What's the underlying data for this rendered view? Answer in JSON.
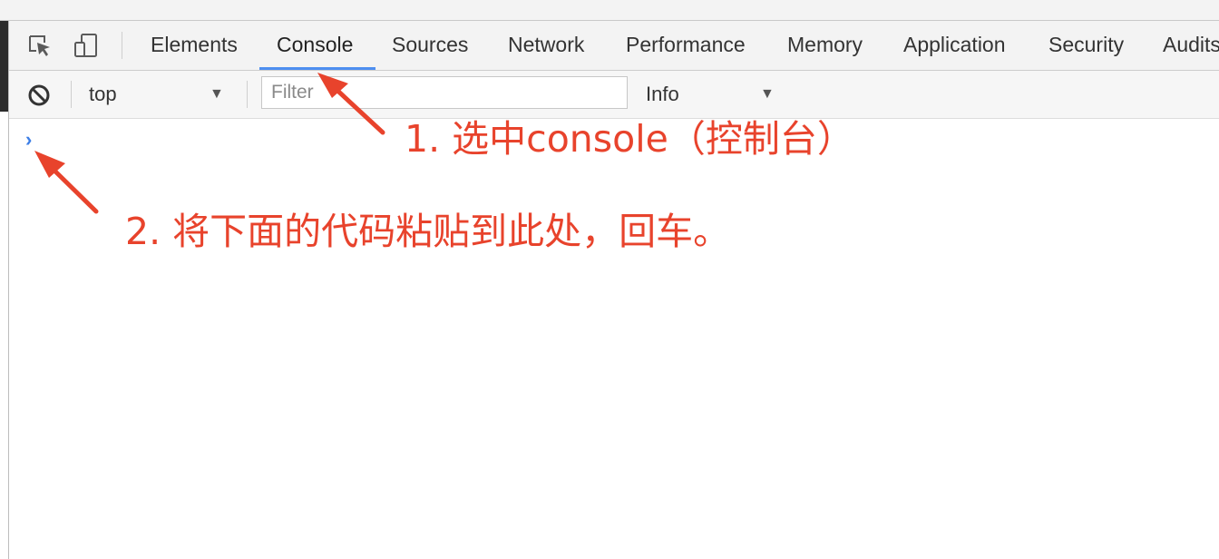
{
  "devtools": {
    "tabs": [
      {
        "label": "Elements",
        "active": false
      },
      {
        "label": "Console",
        "active": true
      },
      {
        "label": "Sources",
        "active": false
      },
      {
        "label": "Network",
        "active": false
      },
      {
        "label": "Performance",
        "active": false
      },
      {
        "label": "Memory",
        "active": false
      },
      {
        "label": "Application",
        "active": false
      },
      {
        "label": "Security",
        "active": false
      },
      {
        "label": "Audits",
        "active": false
      }
    ],
    "accent_color": "#4d8ef0"
  },
  "console_toolbar": {
    "context_value": "top",
    "filter_placeholder": "Filter",
    "log_level_value": "Info"
  },
  "console": {
    "prompt_symbol": "›"
  },
  "annotations": {
    "step1": "1. 选中console（控制台）",
    "step2": "2. 将下面的代码粘贴到此处，回车。",
    "color": "#e8432c"
  }
}
